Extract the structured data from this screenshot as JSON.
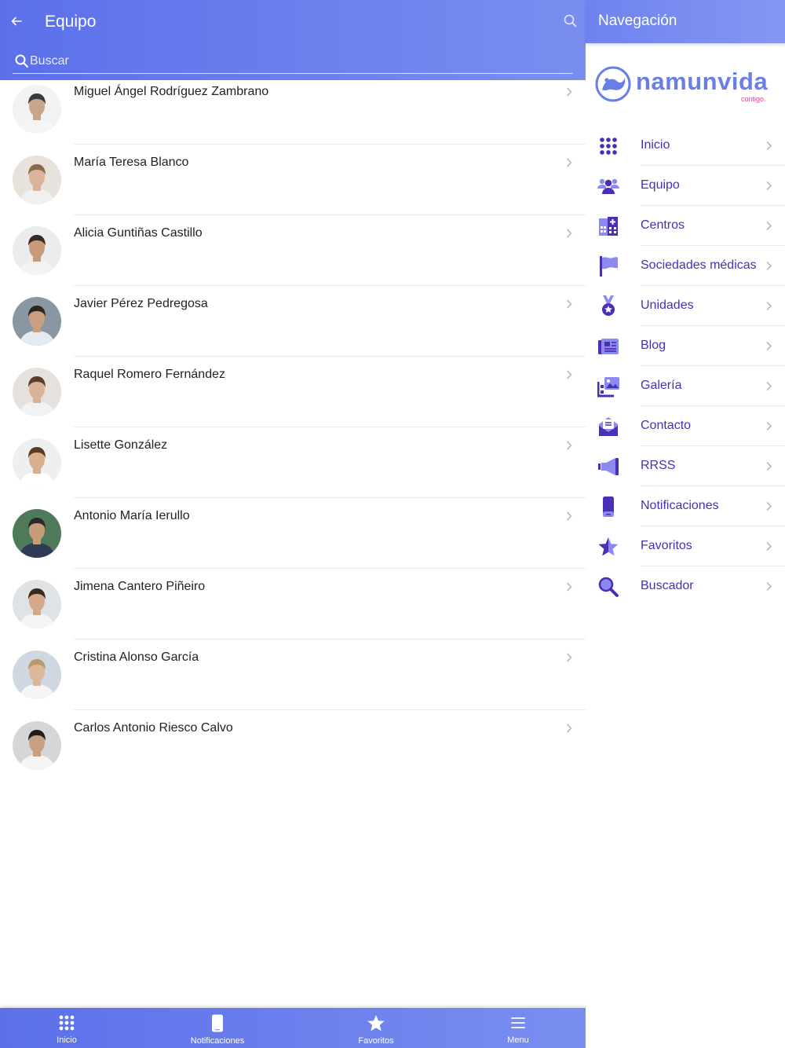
{
  "header": {
    "title": "Equipo",
    "search_placeholder": "Buscar"
  },
  "team": [
    {
      "name": "Miguel Ángel Rodríguez Zambrano"
    },
    {
      "name": "María Teresa Blanco"
    },
    {
      "name": "Alicia Guntiñas Castillo"
    },
    {
      "name": "Javier Pérez Pedregosa"
    },
    {
      "name": "Raquel Romero Fernández"
    },
    {
      "name": "Lisette González"
    },
    {
      "name": "Antonio María Ierullo"
    },
    {
      "name": "Jimena Cantero Piñeiro"
    },
    {
      "name": "Cristina Alonso García"
    },
    {
      "name": "Carlos Antonio Riesco Calvo"
    }
  ],
  "tabbar": {
    "items": [
      {
        "label": "Inicio",
        "icon": "grid-icon"
      },
      {
        "label": "Notificaciones",
        "icon": "phone-icon"
      },
      {
        "label": "Favoritos",
        "icon": "star-icon"
      },
      {
        "label": "Menu",
        "icon": "hamburger-icon"
      }
    ]
  },
  "drawer": {
    "title": "Navegación",
    "logo_text": "namunvida",
    "logo_sub": "contigo.",
    "items": [
      {
        "label": "Inicio",
        "icon": "grid-icon"
      },
      {
        "label": "Equipo",
        "icon": "people-icon"
      },
      {
        "label": "Centros",
        "icon": "hospital-icon"
      },
      {
        "label": "Sociedades médicas",
        "icon": "flag-icon"
      },
      {
        "label": "Unidades",
        "icon": "medal-icon"
      },
      {
        "label": "Blog",
        "icon": "newspaper-icon"
      },
      {
        "label": "Galería",
        "icon": "gallery-icon"
      },
      {
        "label": "Contacto",
        "icon": "envelope-icon"
      },
      {
        "label": "RRSS",
        "icon": "megaphone-icon"
      },
      {
        "label": "Notificaciones",
        "icon": "phone-icon"
      },
      {
        "label": "Favoritos",
        "icon": "star-icon"
      },
      {
        "label": "Buscador",
        "icon": "search-icon"
      }
    ]
  },
  "colors": {
    "header_start": "#5b70ea",
    "header_end": "#7a8ef0",
    "nav_text": "#4a2fb3",
    "nav_icon": "#4a2fb3",
    "nav_icon_light": "#8a8af0",
    "logo": "#6a7ee8",
    "logo_accent": "#e0459a"
  }
}
